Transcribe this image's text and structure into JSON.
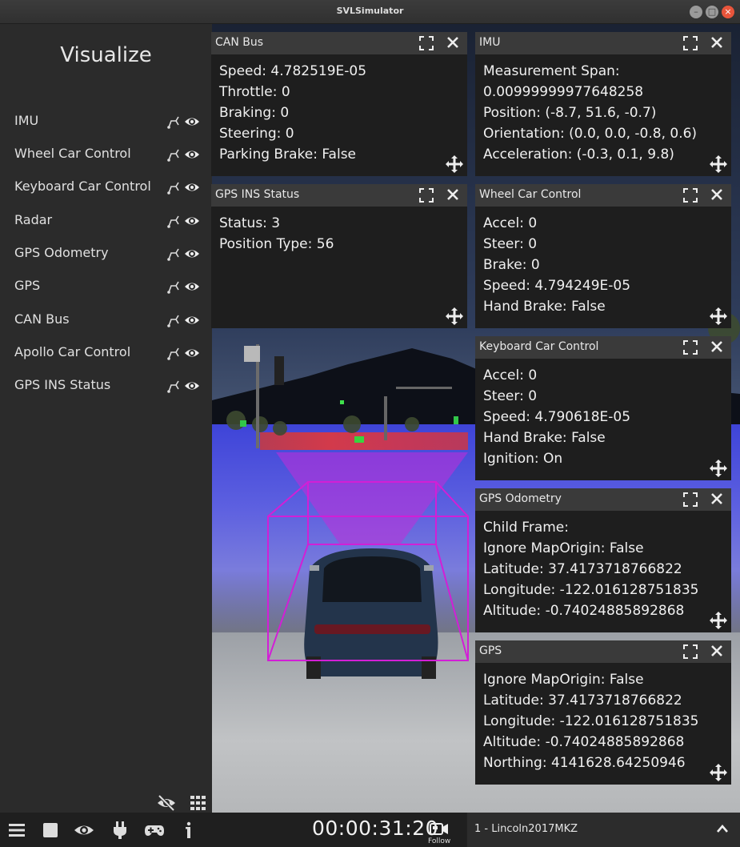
{
  "window": {
    "title": "SVLSimulator",
    "buttons": [
      "minimize",
      "maximize",
      "close"
    ]
  },
  "sidebar": {
    "heading": "Visualize",
    "items": [
      {
        "label": "IMU"
      },
      {
        "label": "Wheel Car Control"
      },
      {
        "label": "Keyboard Car Control"
      },
      {
        "label": "Radar"
      },
      {
        "label": "GPS Odometry"
      },
      {
        "label": "GPS"
      },
      {
        "label": "CAN Bus"
      },
      {
        "label": "Apollo Car Control"
      },
      {
        "label": "GPS INS Status"
      }
    ],
    "item_icons": [
      "route-icon",
      "eye-icon"
    ]
  },
  "panels": {
    "can_bus": {
      "title": "CAN Bus",
      "lines": [
        "Speed: 4.782519E-05",
        "Throttle: 0",
        "Braking: 0",
        "Steering: 0",
        "Parking Brake: False"
      ]
    },
    "imu": {
      "title": "IMU",
      "lines": [
        "Measurement Span:",
        "0.00999999977648258",
        "Position: (-8.7, 51.6, -0.7)",
        "Orientation: (0.0, 0.0, -0.8, 0.6)",
        "Acceleration: (-0.3, 0.1, 9.8)"
      ]
    },
    "gps_ins": {
      "title": "GPS INS Status",
      "lines": [
        "Status: 3",
        "Position Type: 56"
      ]
    },
    "wheel": {
      "title": "Wheel Car Control",
      "lines": [
        "Accel: 0",
        "Steer: 0",
        "Brake: 0",
        "Speed: 4.794249E-05",
        "Hand Brake: False"
      ]
    },
    "keyboard": {
      "title": "Keyboard Car Control",
      "lines": [
        "Accel: 0",
        "Steer: 0",
        "Speed: 4.790618E-05",
        "Hand Brake: False",
        "Ignition: On"
      ]
    },
    "odometry": {
      "title": "GPS Odometry",
      "lines": [
        "Child Frame:",
        "Ignore MapOrigin: False",
        "Latitude: 37.4173718766822",
        "Longitude: -122.016128751835",
        "Altitude: -0.74024885892868"
      ]
    },
    "gps": {
      "title": "GPS",
      "lines": [
        "Ignore MapOrigin: False",
        "Latitude: 37.4173718766822",
        "Longitude: -122.016128751835",
        "Altitude: -0.74024885892868",
        "Northing: 4141628.64250946"
      ]
    }
  },
  "bottom_bar": {
    "icons": [
      "menu-icon",
      "stop-icon",
      "eye-icon",
      "plug-icon",
      "gamepad-icon",
      "info-icon"
    ],
    "clock": "00:00:31:20",
    "camera_label": "Follow",
    "agent": "1 - Lincoln2017MKZ"
  },
  "colors": {
    "panel_header": "#3a3a3a",
    "panel_body": "#1e1e1e",
    "sidebar": "#2b2b2b",
    "bounding_box": "#d21fd6",
    "close_button": "#e9553b"
  }
}
